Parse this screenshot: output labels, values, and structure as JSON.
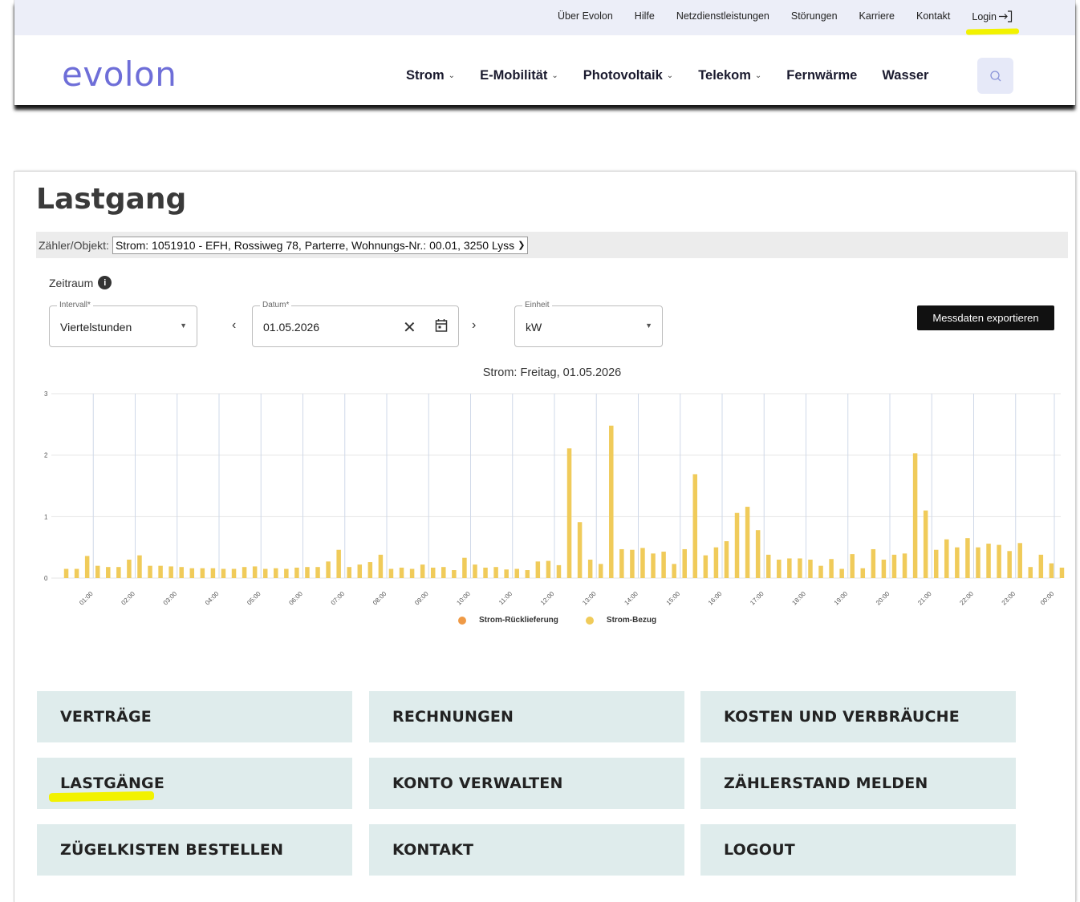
{
  "topbar": {
    "links": [
      "Über Evolon",
      "Hilfe",
      "Netzdienstleistungen",
      "Störungen",
      "Karriere",
      "Kontakt"
    ],
    "login": "Login"
  },
  "brand": {
    "logo_text": "evolon",
    "color": "#6e6ed8"
  },
  "nav": {
    "items": [
      {
        "label": "Strom",
        "dropdown": true
      },
      {
        "label": "E-Mobilität",
        "dropdown": true
      },
      {
        "label": "Photovoltaik",
        "dropdown": true
      },
      {
        "label": "Telekom",
        "dropdown": true
      },
      {
        "label": "Fernwärme",
        "dropdown": false
      },
      {
        "label": "Wasser",
        "dropdown": false
      }
    ],
    "search_icon": "search-icon"
  },
  "page": {
    "title": "Lastgang",
    "meter_label": "Zähler/Objekt:",
    "meter_value": "Strom: 1051910 - EFH, Rossiweg 78, Parterre, Wohnungs-Nr.: 00.01, 3250 Lyss",
    "zeitraum_label": "Zeitraum"
  },
  "filters": {
    "intervall": {
      "label": "Intervall*",
      "value": "Viertelstunden"
    },
    "datum": {
      "label": "Datum*",
      "value": "01.05.2026"
    },
    "einheit": {
      "label": "Einheit",
      "value": "kW"
    },
    "export_label": "Messdaten exportieren"
  },
  "chart_data": {
    "type": "bar",
    "title": "Strom: Freitag, 01.05.2026",
    "ylim": [
      0,
      3
    ],
    "yticks": [
      "0",
      "1",
      "2",
      "3"
    ],
    "xtick_labels": [
      "01:00",
      "02:00",
      "03:00",
      "04:00",
      "05:00",
      "06:00",
      "07:00",
      "08:00",
      "09:00",
      "10:00",
      "11:00",
      "12:00",
      "13:00",
      "14:00",
      "15:00",
      "16:00",
      "17:00",
      "18:00",
      "19:00",
      "20:00",
      "21:00",
      "22:00",
      "23:00",
      "00:00"
    ],
    "legend": [
      "Strom-Rücklieferung",
      "Strom-Bezug"
    ],
    "colors": {
      "ruecklieferung": "#ef9a46",
      "bezug": "#f0cb5a",
      "grid": "#cfd8e8"
    },
    "series": [
      {
        "name": "Strom-Bezug",
        "values": [
          0.15,
          0.15,
          0.36,
          0.2,
          0.18,
          0.18,
          0.3,
          0.37,
          0.2,
          0.2,
          0.19,
          0.18,
          0.16,
          0.16,
          0.16,
          0.15,
          0.15,
          0.18,
          0.19,
          0.15,
          0.16,
          0.15,
          0.17,
          0.18,
          0.18,
          0.27,
          0.46,
          0.18,
          0.22,
          0.26,
          0.38,
          0.15,
          0.17,
          0.15,
          0.22,
          0.17,
          0.18,
          0.13,
          0.33,
          0.22,
          0.17,
          0.18,
          0.14,
          0.15,
          0.13,
          0.27,
          0.28,
          0.21,
          2.11,
          0.91,
          0.3,
          0.23,
          2.48,
          0.47,
          0.46,
          0.49,
          0.4,
          0.43,
          0.23,
          0.47,
          1.69,
          0.37,
          0.5,
          0.6,
          1.06,
          1.16,
          0.78,
          0.38,
          0.3,
          0.32,
          0.32,
          0.3,
          0.2,
          0.31,
          0.15,
          0.39,
          0.16,
          0.47,
          0.3,
          0.38,
          0.4,
          2.03,
          1.1,
          0.46,
          0.63,
          0.5,
          0.65,
          0.5,
          0.56,
          0.54,
          0.44,
          0.57,
          0.18,
          0.38,
          0.24,
          0.17
        ]
      },
      {
        "name": "Strom-Rücklieferung",
        "values": []
      }
    ]
  },
  "tiles": [
    "VERTRÄGE",
    "RECHNUNGEN",
    "KOSTEN UND VERBRÄUCHE",
    "LASTGÄNGE",
    "KONTO VERWALTEN",
    "ZÄHLERSTAND MELDEN",
    "ZÜGELKISTEN BESTELLEN",
    "KONTAKT",
    "LOGOUT"
  ]
}
